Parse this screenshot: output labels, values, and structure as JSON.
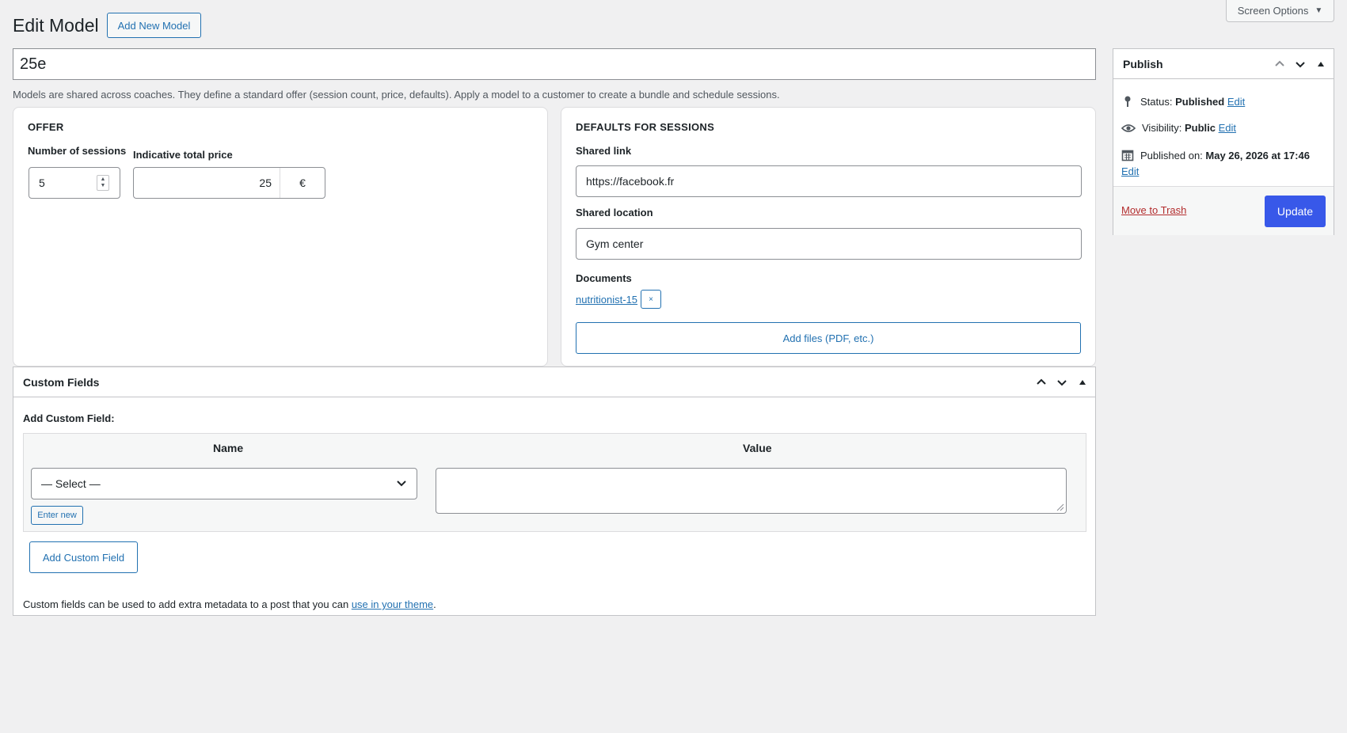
{
  "header": {
    "screen_options_label": "Screen Options",
    "title": "Edit Model",
    "add_new_label": "Add New Model"
  },
  "post": {
    "title_value": "25e",
    "description": "Models are shared across coaches. They define a standard offer (session count, price, defaults). Apply a model to a customer to create a bundle and schedule sessions."
  },
  "offer": {
    "heading": "OFFER",
    "sessions_label": "Number of sessions",
    "sessions_value": "5",
    "price_label": "Indicative total price",
    "price_value": "25",
    "currency": "€"
  },
  "defaults": {
    "heading": "DEFAULTS FOR SESSIONS",
    "link_label": "Shared link",
    "link_value": "https://facebook.fr",
    "location_label": "Shared location",
    "location_value": "Gym center",
    "documents_label": "Documents",
    "document_name": "nutritionist-15",
    "remove_glyph": "×",
    "add_files_label": "Add files (PDF, etc.)"
  },
  "custom_fields": {
    "heading": "Custom Fields",
    "add_label": "Add Custom Field:",
    "col_name": "Name",
    "col_value": "Value",
    "select_value": "— Select —",
    "enter_new_label": "Enter new",
    "add_button_label": "Add Custom Field",
    "footer_text": "Custom fields can be used to add extra metadata to a post that you can",
    "footer_link": "use in your theme",
    "footer_end": "."
  },
  "publish": {
    "heading": "Publish",
    "status_label": "Status:",
    "status_value": "Published",
    "visibility_label": "Visibility:",
    "visibility_value": "Public",
    "published_label": "Published on:",
    "published_value": "May 26, 2026 at 17:46",
    "edit_label": "Edit",
    "trash_label": "Move to Trash",
    "update_label": "Update"
  },
  "colors": {
    "accent": "#2271b1",
    "primary_button": "#3858e9",
    "danger": "#b32d2e",
    "background": "#f0f0f1"
  },
  "icons": [
    "caret-down-icon",
    "pin-icon",
    "eye-icon",
    "calendar-icon",
    "chevron-up-icon",
    "chevron-down-icon",
    "triangle-up-icon",
    "select-chevron-icon",
    "spinner-arrows-icon"
  ]
}
